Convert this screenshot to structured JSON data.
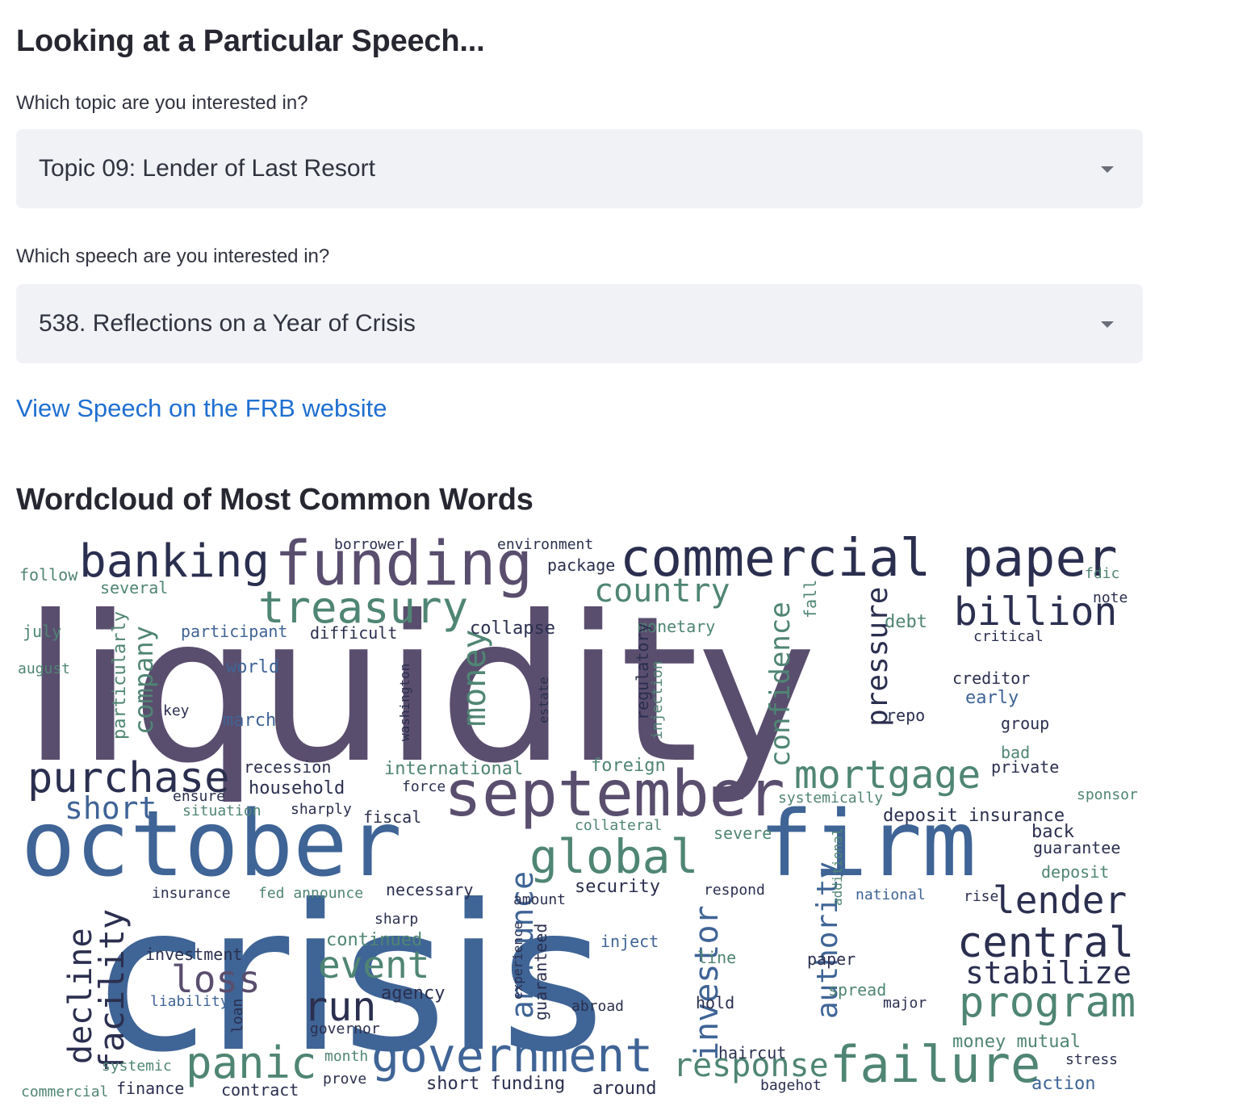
{
  "section_title": "Looking at a Particular Speech...",
  "topic_select": {
    "label": "Which topic are you interested in?",
    "value": "Topic 09: Lender of Last Resort"
  },
  "speech_select": {
    "label": "Which speech are you interested in?",
    "value": "538. Reflections on a Year of Crisis"
  },
  "speech_link": "View Speech on the FRB website",
  "wordcloud_title": "Wordcloud of Most Common Words",
  "colors": {
    "purple": "#5a4e6e",
    "blue": "#3f6496",
    "teal": "#4f8574",
    "navy": "#2b2f4f",
    "link": "#1f6fd1"
  },
  "wordcloud_words": [
    "liquidity",
    "crisis",
    "october",
    "firm",
    "september",
    "funding",
    "commercial paper",
    "banking",
    "treasury",
    "country",
    "billion",
    "purchase",
    "global",
    "mortgage",
    "confidence",
    "pressure",
    "company",
    "particularly",
    "money",
    "government",
    "panic",
    "failure",
    "program",
    "central",
    "lender",
    "stabilize",
    "response",
    "investor",
    "authority",
    "announce",
    "facility",
    "decline",
    "run",
    "loss",
    "event",
    "short",
    "follow",
    "several",
    "july",
    "august",
    "participant",
    "difficult",
    "collapse",
    "monetary",
    "fall",
    "debt",
    "note",
    "critical",
    "fdic",
    "borrower",
    "environment",
    "package",
    "world",
    "key",
    "march",
    "washington",
    "estate",
    "regulatory",
    "injection",
    "creditor",
    "early",
    "repo",
    "group",
    "bad",
    "private",
    "sponsor",
    "recession",
    "household",
    "ensure",
    "situation",
    "sharply",
    "fiscal",
    "international",
    "force",
    "foreign",
    "collateral",
    "severe",
    "systemically",
    "deposit insurance",
    "back",
    "guarantee",
    "deposit",
    "insurance",
    "fed announce",
    "necessary",
    "amount",
    "security",
    "respond",
    "national",
    "rise",
    "sharp",
    "continued",
    "inject",
    "line",
    "paper",
    "investment",
    "experience",
    "guaranteed",
    "additional",
    "liability",
    "loan",
    "agency",
    "abroad",
    "hold",
    "spread",
    "major",
    "governor",
    "money mutual",
    "systemic",
    "month",
    "haircut",
    "stress",
    "finance",
    "commercial",
    "contract",
    "prove",
    "short funding",
    "around",
    "bagehot",
    "action"
  ]
}
